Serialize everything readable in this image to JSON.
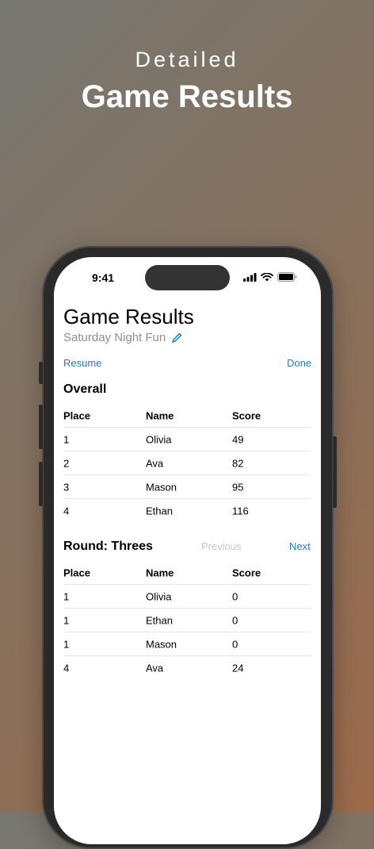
{
  "promo": {
    "subtitle": "Detailed",
    "title": "Game Results"
  },
  "status_bar": {
    "time": "9:41"
  },
  "app": {
    "title": "Game Results",
    "game_name": "Saturday Night Fun",
    "resume_label": "Resume",
    "done_label": "Done"
  },
  "overall": {
    "title": "Overall",
    "headers": [
      "Place",
      "Name",
      "Score"
    ],
    "rows": [
      [
        "1",
        "Olivia",
        "49"
      ],
      [
        "2",
        "Ava",
        "82"
      ],
      [
        "3",
        "Mason",
        "95"
      ],
      [
        "4",
        "Ethan",
        "116"
      ]
    ]
  },
  "round": {
    "title": "Round: Threes",
    "previous_label": "Previous",
    "next_label": "Next",
    "headers": [
      "Place",
      "Name",
      "Score"
    ],
    "rows": [
      [
        "1",
        "Olivia",
        "0"
      ],
      [
        "1",
        "Ethan",
        "0"
      ],
      [
        "1",
        "Mason",
        "0"
      ],
      [
        "4",
        "Ava",
        "24"
      ]
    ]
  },
  "colors": {
    "accent": "#1f7ae0",
    "disabled": "#c7c7cc",
    "secondary_text": "#8e8e93"
  },
  "icons": [
    "pencil-icon",
    "signal-icon",
    "wifi-icon",
    "battery-icon"
  ]
}
